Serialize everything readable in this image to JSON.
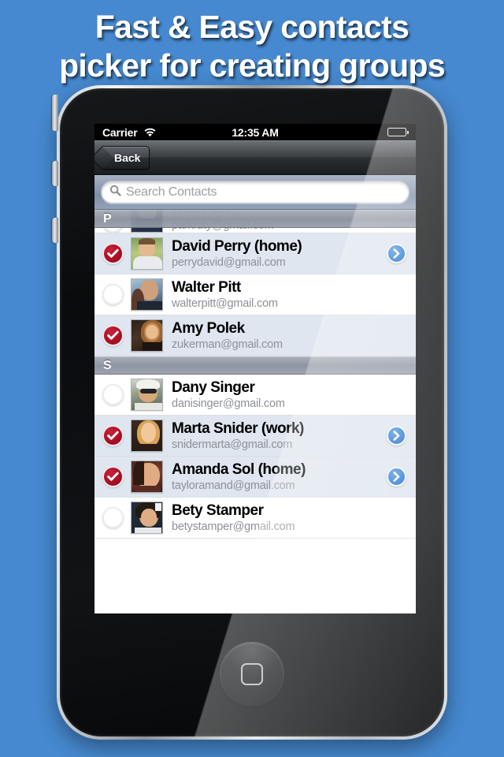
{
  "headline": {
    "line1": "Fast & Easy contacts",
    "line2": "picker for creating groups"
  },
  "colors": {
    "background_blue": "#4689d0",
    "checked_red": "#ad0f25",
    "disclosure_blue": "#2f7fd4",
    "selected_row": "#dfe6f0",
    "section_header_gray": "#868e9b"
  },
  "status_bar": {
    "carrier": "Carrier",
    "wifi_icon": "wifi-icon",
    "time": "12:35 AM",
    "battery_icon": "battery-icon"
  },
  "nav_bar": {
    "back_label": "Back",
    "back_icon": "back-arrow-icon"
  },
  "search": {
    "icon": "search-icon",
    "placeholder": "Search Contacts",
    "value": ""
  },
  "sections": [
    {
      "letter": "P"
    },
    {
      "letter": "S"
    }
  ],
  "contacts": [
    {
      "name": "Ruti Park",
      "email": "parkruty@gmail.com",
      "selected": false,
      "has_disclosure": false,
      "section": "P",
      "clipped": true
    },
    {
      "name": "David Perry (home)",
      "email": "perrydavid@gmail.com",
      "selected": true,
      "has_disclosure": true,
      "section": "P",
      "clipped": false
    },
    {
      "name": "Walter Pitt",
      "email": "walterpitt@gmail.com",
      "selected": false,
      "has_disclosure": false,
      "section": "P",
      "clipped": false
    },
    {
      "name": "Amy Polek",
      "email": "zukerman@gmail.com",
      "selected": true,
      "has_disclosure": false,
      "section": "P",
      "clipped": false
    },
    {
      "name": "Dany Singer",
      "email": "danisinger@gmail.com",
      "selected": false,
      "has_disclosure": false,
      "section": "S",
      "clipped": false
    },
    {
      "name": "Marta Snider (work)",
      "email": "snidermarta@gmail.com",
      "selected": true,
      "has_disclosure": true,
      "section": "S",
      "clipped": false
    },
    {
      "name": "Amanda Sol (home)",
      "email": "tayloramand@gmail.com",
      "selected": true,
      "has_disclosure": true,
      "section": "S",
      "clipped": false
    },
    {
      "name": "Bety Stamper",
      "email": "betystamper@gmail.com",
      "selected": false,
      "has_disclosure": false,
      "section": "S",
      "clipped": false
    }
  ],
  "device": {
    "home_button_icon": "home-button-icon",
    "silent_switch": "silent-switch",
    "volume_up": "volume-up-button",
    "volume_down": "volume-down-button"
  }
}
